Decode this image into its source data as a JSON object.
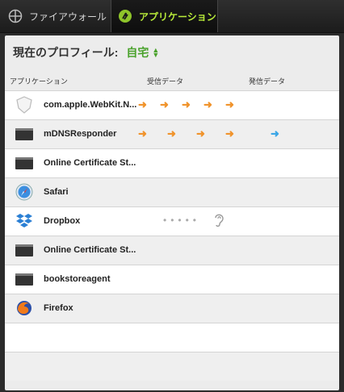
{
  "tabs": [
    {
      "label": "ファイアウォール",
      "active": false
    },
    {
      "label": "アプリケーション",
      "active": true
    }
  ],
  "profile": {
    "label": "現在のプロフィール:",
    "value": "自宅"
  },
  "columns": {
    "app": "アプリケーション",
    "received": "受信データ",
    "sent": "発信データ"
  },
  "apps": [
    {
      "name": "com.apple.WebKit.N...",
      "icon": "shield-icon",
      "received_arrows": 5,
      "sent_arrows": 0
    },
    {
      "name": "mDNSResponder",
      "icon": "terminal-app-icon",
      "received_arrows": 4,
      "sent_arrows": 1
    },
    {
      "name": "Online Certificate St...",
      "icon": "terminal-app-icon",
      "received_arrows": 0,
      "sent_arrows": 0
    },
    {
      "name": "Safari",
      "icon": "safari-icon",
      "received_arrows": 0,
      "sent_arrows": 0
    },
    {
      "name": "Dropbox",
      "icon": "dropbox-icon",
      "received_arrows": 0,
      "sent_arrows": 0,
      "listening": true
    },
    {
      "name": "Online Certificate St...",
      "icon": "terminal-app-icon",
      "received_arrows": 0,
      "sent_arrows": 0
    },
    {
      "name": "bookstoreagent",
      "icon": "terminal-app-icon",
      "received_arrows": 0,
      "sent_arrows": 0
    },
    {
      "name": "Firefox",
      "icon": "firefox-icon",
      "received_arrows": 0,
      "sent_arrows": 0
    }
  ],
  "colors": {
    "accent_green": "#b9ec3a",
    "profile_green": "#4aa22c",
    "received_arrow": "#f0932b",
    "sent_arrow": "#3aa6e6"
  }
}
